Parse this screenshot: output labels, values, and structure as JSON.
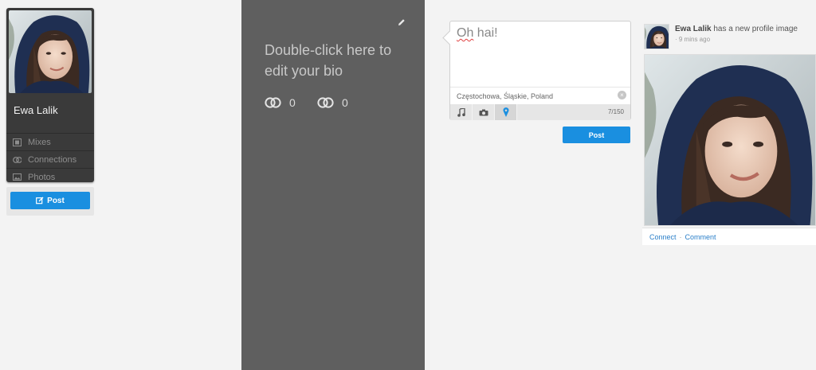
{
  "profile": {
    "name": "Ewa Lalik",
    "nav": [
      {
        "label": "Mixes",
        "icon": "mixes-icon"
      },
      {
        "label": "Connections",
        "icon": "connections-icon"
      },
      {
        "label": "Photos",
        "icon": "photos-icon"
      }
    ],
    "post_label": "Post"
  },
  "bio": {
    "placeholder": "Double-click here to edit your bio",
    "stats": [
      {
        "icon": "connections-icon",
        "value": "0"
      },
      {
        "icon": "connections-icon",
        "value": "0"
      }
    ]
  },
  "composer": {
    "text_word1": "Oh",
    "text_word2": " hai!",
    "location": "Częstochowa, Śląskie, Poland",
    "char_count": "7/150",
    "tools": [
      "music-icon",
      "camera-icon",
      "location-pin-icon"
    ],
    "post_label": "Post"
  },
  "feed": {
    "author": "Ewa Lalik",
    "action": " has a new profile image",
    "time": "· 9 mins ago",
    "connect_label": "Connect",
    "separator": "·",
    "comment_label": "Comment"
  },
  "colors": {
    "accent": "#1a8fe0",
    "bio_panel": "#5f5f5f",
    "card": "#3a3a3a",
    "location_pin": "#1a8fe0"
  }
}
